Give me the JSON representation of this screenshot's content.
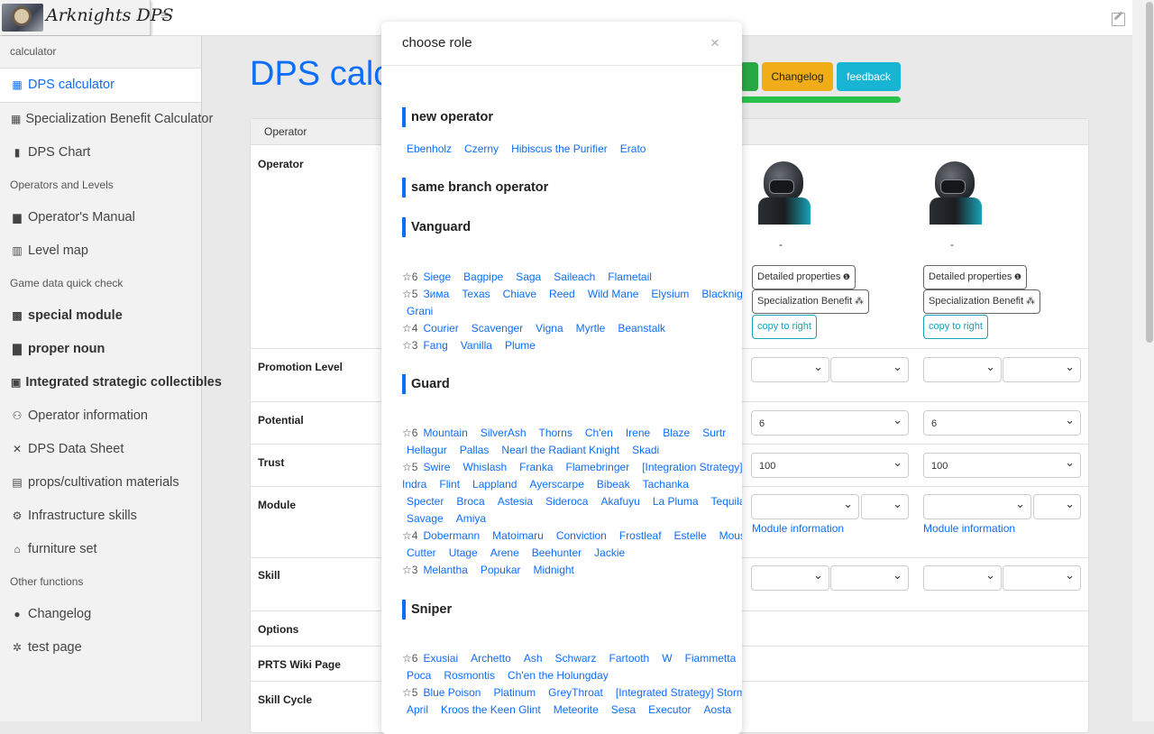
{
  "app": {
    "title": "Arknights DPS"
  },
  "sidebar": {
    "sections": [
      {
        "label": "calculator",
        "items": [
          {
            "label": "DPS calculator",
            "icon": "calculator-icon",
            "glyph": "▦",
            "active": true
          },
          {
            "label": "Specialization Benefit Calculator",
            "icon": "calculator-icon",
            "glyph": "▦"
          },
          {
            "label": "DPS Chart",
            "icon": "signal-bars-icon",
            "glyph": "▮"
          }
        ]
      },
      {
        "label": "Operators and Levels",
        "items": [
          {
            "label": "Operator's Manual",
            "icon": "file-icon",
            "glyph": "▆"
          },
          {
            "label": "Level map",
            "icon": "map-icon",
            "glyph": "▥"
          }
        ]
      },
      {
        "label": "Game data quick check",
        "items": [
          {
            "label": "special module",
            "icon": "grid-icon",
            "glyph": "▩",
            "bold": true
          },
          {
            "label": "proper noun",
            "icon": "book-icon",
            "glyph": "▇",
            "bold": true
          },
          {
            "label": "Integrated strategic collectibles",
            "icon": "lock-icon",
            "glyph": "▣",
            "bold": true
          },
          {
            "label": "Operator information",
            "icon": "users-icon",
            "glyph": "⚇"
          },
          {
            "label": "DPS Data Sheet",
            "icon": "shuffle-icon",
            "glyph": "✕"
          },
          {
            "label": "props/cultivation materials",
            "icon": "suitcase-icon",
            "glyph": "▤"
          },
          {
            "label": "Infrastructure skills",
            "icon": "gears-icon",
            "glyph": "⚙"
          },
          {
            "label": "furniture set",
            "icon": "home-icon",
            "glyph": "⌂"
          }
        ]
      },
      {
        "label": "Other functions",
        "items": [
          {
            "label": "Changelog",
            "icon": "info-circle-icon",
            "glyph": "●"
          },
          {
            "label": "test page",
            "icon": "bug-icon",
            "glyph": "✲"
          }
        ]
      }
    ]
  },
  "main": {
    "title": "DPS calcu",
    "buttons": {
      "changelog": "Changelog",
      "feedback": "feedback"
    },
    "card_header": "Operator",
    "rows": {
      "operator": "Operator",
      "promotion": "Promotion Level",
      "potential": "Potential",
      "trust": "Trust",
      "module": "Module",
      "skill": "Skill",
      "options": "Options",
      "wiki": "PRTS Wiki Page",
      "cycle": "Skill Cycle"
    },
    "columns": [
      {
        "name": "-",
        "detailed": "Detailed properties",
        "spec": "Specialization Benefit",
        "copy": "copy to right",
        "potential": "6",
        "trust": "100",
        "module_info": "Module information"
      },
      {
        "name": "-",
        "detailed": "Detailed properties",
        "spec": "Specialization Benefit",
        "copy": "copy to right",
        "potential": "6",
        "trust": "100",
        "module_info": "Module information"
      }
    ]
  },
  "modal": {
    "title": "choose role",
    "close": "×",
    "groups": {
      "new": {
        "title": "new operator",
        "lines": [
          [
            "Ebenholz",
            "Czerny",
            "Hibiscus the Purifier",
            "Erato"
          ]
        ]
      },
      "same": {
        "title": "same branch operator"
      },
      "vanguard": {
        "title": "Vanguard",
        "lines": [
          {
            "star": "☆6",
            "ops": [
              "Siege",
              "Bagpipe",
              "Saga",
              "Saileach",
              "Flametail"
            ]
          },
          {
            "star": "☆5",
            "ops": [
              "Зима",
              "Texas",
              "Chiave",
              "Reed",
              "Wild Mane",
              "Elysium",
              "Blacknight",
              "Grani"
            ]
          },
          {
            "star": "☆4",
            "ops": [
              "Courier",
              "Scavenger",
              "Vigna",
              "Myrtle",
              "Beanstalk"
            ]
          },
          {
            "star": "☆3",
            "ops": [
              "Fang",
              "Vanilla",
              "Plume"
            ]
          }
        ]
      },
      "guard": {
        "title": "Guard",
        "lines": [
          {
            "star": "☆6",
            "ops": [
              "Mountain",
              "SilverAsh",
              "Thorns",
              "Ch'en",
              "Irene",
              "Blaze",
              "Surtr",
              "Hellagur",
              "Pallas",
              "Nearl the Radiant Knight",
              "Skadi"
            ]
          },
          {
            "star": "☆5",
            "ops": [
              "Swire",
              "Whislash",
              "Franka",
              "Flamebringer",
              "[Integration Strategy] Sharp",
              "Indra",
              "Flint",
              "Lappland",
              "Ayerscarpe",
              "Bibeak",
              "Tachanka",
              "Specter",
              "Broca",
              "Astesia",
              "Sideroca",
              "Akafuyu",
              "La Pluma",
              "Tequila",
              "Savage",
              "Amiya"
            ]
          },
          {
            "star": "☆4",
            "ops": [
              "Dobermann",
              "Matoimaru",
              "Conviction",
              "Frostleaf",
              "Estelle",
              "Mousse",
              "Cutter",
              "Utage",
              "Arene",
              "Beehunter",
              "Jackie"
            ]
          },
          {
            "star": "☆3",
            "ops": [
              "Melantha",
              "Popukar",
              "Midnight"
            ]
          }
        ]
      },
      "sniper": {
        "title": "Sniper",
        "lines": [
          {
            "star": "☆6",
            "ops": [
              "Exusiai",
              "Archetto",
              "Ash",
              "Schwarz",
              "Fartooth",
              "W",
              "Fiammetta",
              "Poca",
              "Rosmontis",
              "Ch'en the Holungday"
            ]
          },
          {
            "star": "☆5",
            "ops": [
              "Blue Poison",
              "Platinum",
              "GreyThroat",
              "[Integrated Strategy] Stormeye",
              "April",
              "Kroos the Keen Glint",
              "Meteorite",
              "Sesa",
              "Executor",
              "Aosta"
            ]
          }
        ]
      }
    }
  }
}
